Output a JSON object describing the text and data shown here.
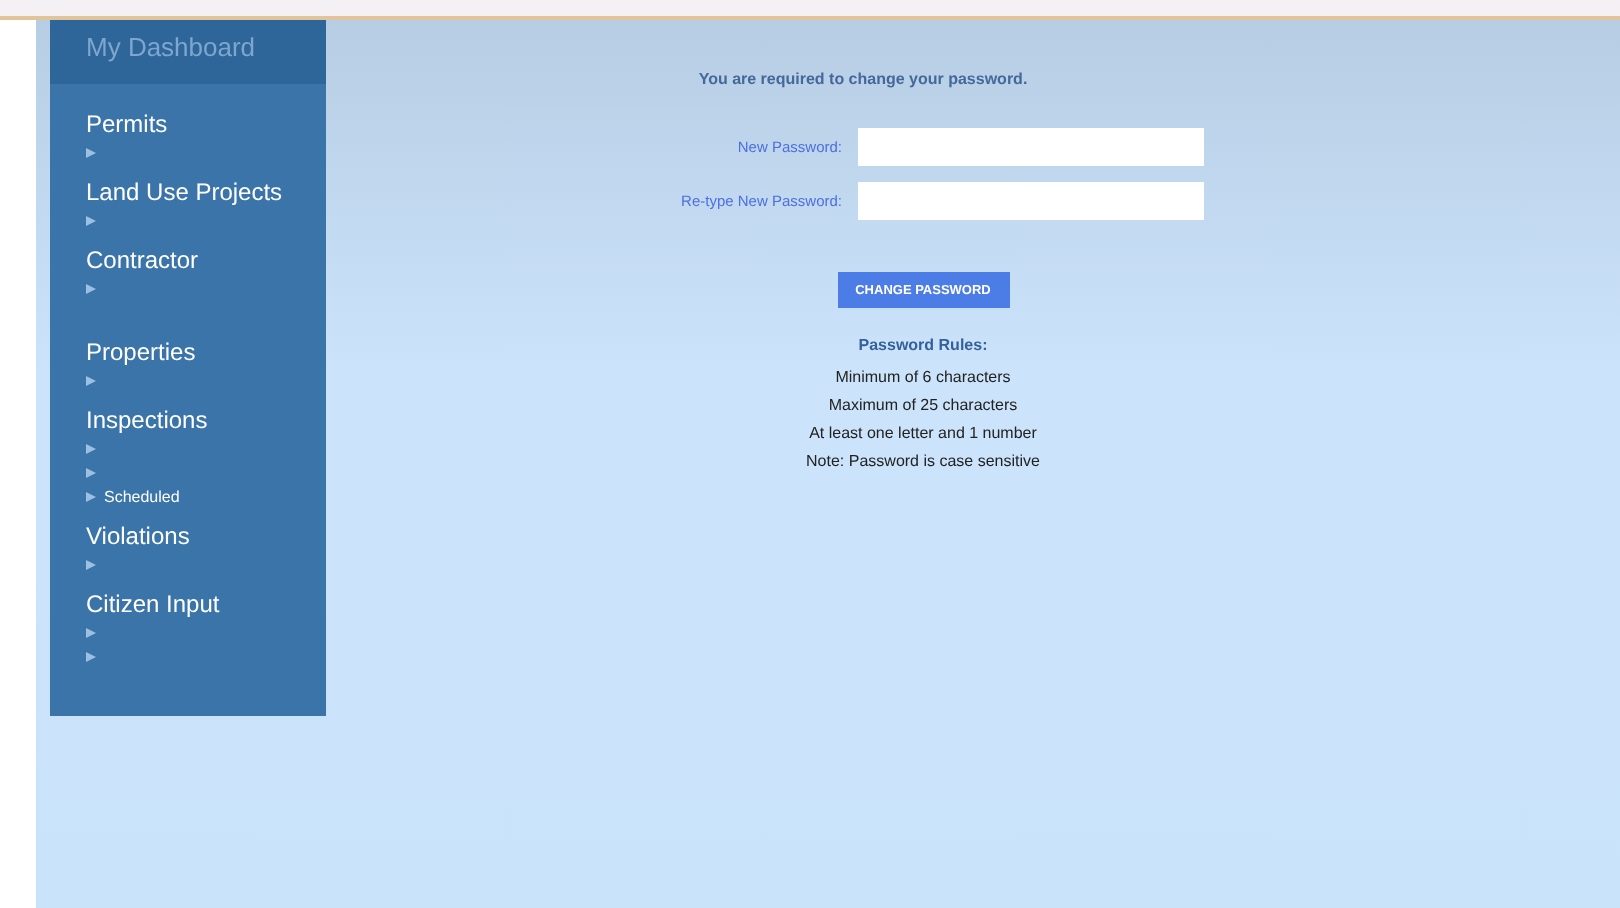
{
  "sidebar": {
    "title": "My Dashboard",
    "sections": [
      {
        "heading": "Permits",
        "items": [
          {
            "kind": "blank"
          }
        ]
      },
      {
        "heading": "Land Use Projects",
        "items": [
          {
            "kind": "blank"
          }
        ]
      },
      {
        "heading": "Contractor",
        "items": [
          {
            "kind": "blank_tall"
          }
        ]
      },
      {
        "heading": "Properties",
        "items": [
          {
            "kind": "blank"
          }
        ]
      },
      {
        "heading": "Inspections",
        "items": [
          {
            "kind": "blank"
          },
          {
            "kind": "blank"
          },
          {
            "kind": "link",
            "label": "Scheduled"
          }
        ]
      },
      {
        "heading": "Violations",
        "items": [
          {
            "kind": "blank"
          }
        ]
      },
      {
        "heading": "Citizen Input",
        "items": [
          {
            "kind": "blank"
          },
          {
            "kind": "blank"
          }
        ]
      }
    ]
  },
  "form": {
    "notice": "You are required to change your password.",
    "fields": [
      {
        "label": "New Password:"
      },
      {
        "label": "Re-type New Password:"
      }
    ],
    "button": "CHANGE PASSWORD",
    "rules_title": "Password Rules:",
    "rules": [
      "Minimum of 6 characters",
      "Maximum of 25 characters",
      "At least one letter and 1 number",
      "Note: Password is case sensitive"
    ]
  }
}
